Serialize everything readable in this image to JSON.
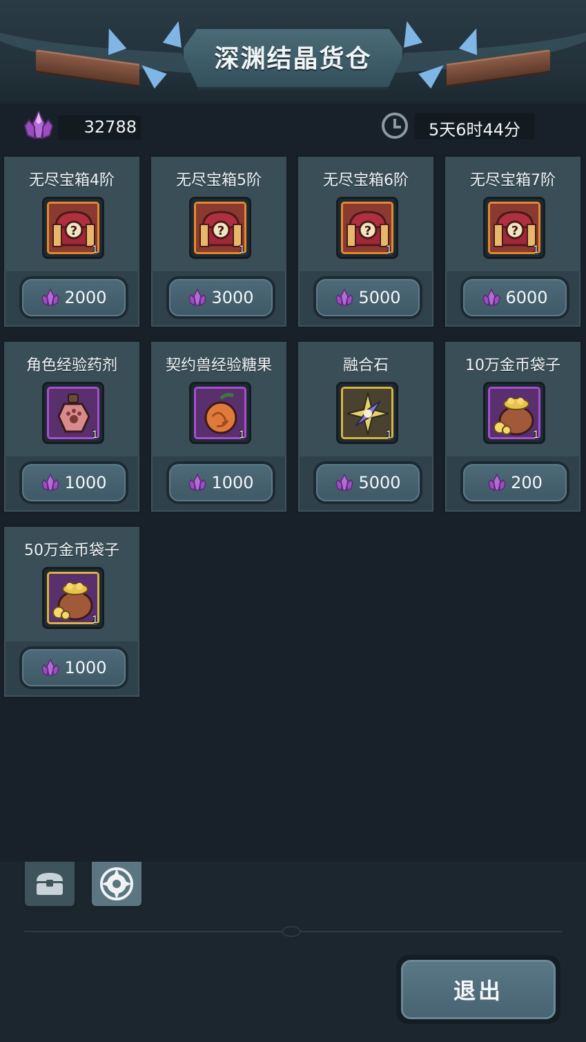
{
  "header": {
    "title": "深渊结晶货仓"
  },
  "currency": {
    "amount": "32788",
    "icon": "purple-crystal-icon"
  },
  "timer": {
    "remaining": "5天6时44分",
    "icon": "clock-icon"
  },
  "items": [
    {
      "name": "无尽宝箱4阶",
      "count": "1",
      "price": "2000",
      "icon": "chest-icon",
      "rarity": "orange"
    },
    {
      "name": "无尽宝箱5阶",
      "count": "1",
      "price": "3000",
      "icon": "chest-icon",
      "rarity": "orange"
    },
    {
      "name": "无尽宝箱6阶",
      "count": "1",
      "price": "5000",
      "icon": "chest-icon",
      "rarity": "orange"
    },
    {
      "name": "无尽宝箱7阶",
      "count": "1",
      "price": "6000",
      "icon": "chest-icon",
      "rarity": "orange"
    },
    {
      "name": "角色经验药剂",
      "count": "1",
      "price": "1000",
      "icon": "potion-icon",
      "rarity": "purple"
    },
    {
      "name": "契约兽经验糖果",
      "count": "1",
      "price": "1000",
      "icon": "fruit-icon",
      "rarity": "purple"
    },
    {
      "name": "融合石",
      "count": "1",
      "price": "5000",
      "icon": "fusion-stone-icon",
      "rarity": "gold"
    },
    {
      "name": "10万金币袋子",
      "count": "1",
      "price": "200",
      "icon": "gold-bag-icon",
      "rarity": "purple"
    },
    {
      "name": "50万金币袋子",
      "count": "1",
      "price": "1000",
      "icon": "gold-bag-icon",
      "rarity": "gold"
    }
  ],
  "tabs": [
    {
      "icon": "chest-tab-icon"
    },
    {
      "icon": "compass-tab-icon"
    }
  ],
  "exit": {
    "label": "退出"
  }
}
